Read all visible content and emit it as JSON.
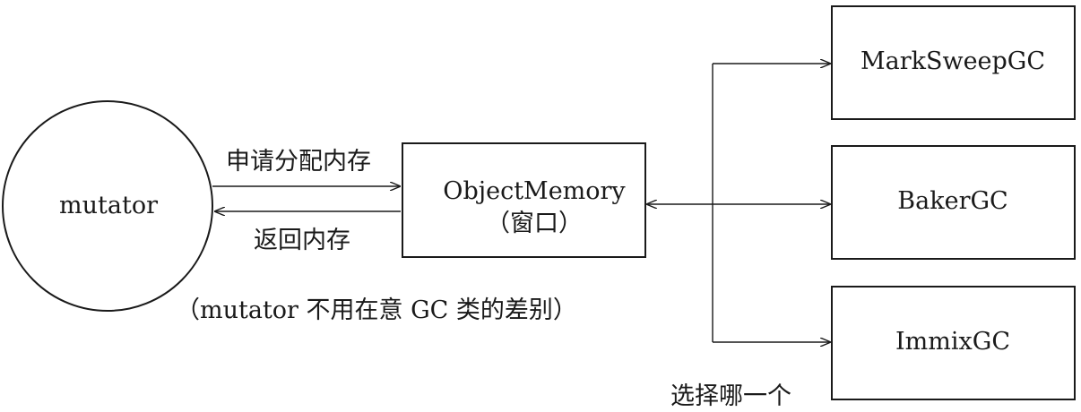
{
  "nodes": {
    "mutator": "mutator",
    "object_memory": "ObjectMemory",
    "object_memory_sub": "（窗口）",
    "gc_options": [
      "MarkSweepGC",
      "BakerGC",
      "ImmixGC"
    ]
  },
  "edges": {
    "request_memory": "申请分配内存",
    "return_memory": "返回内存",
    "select_one": "选择哪一个"
  },
  "notes": {
    "mutator_note": "（mutator 不用在意 GC 类的差别）"
  }
}
